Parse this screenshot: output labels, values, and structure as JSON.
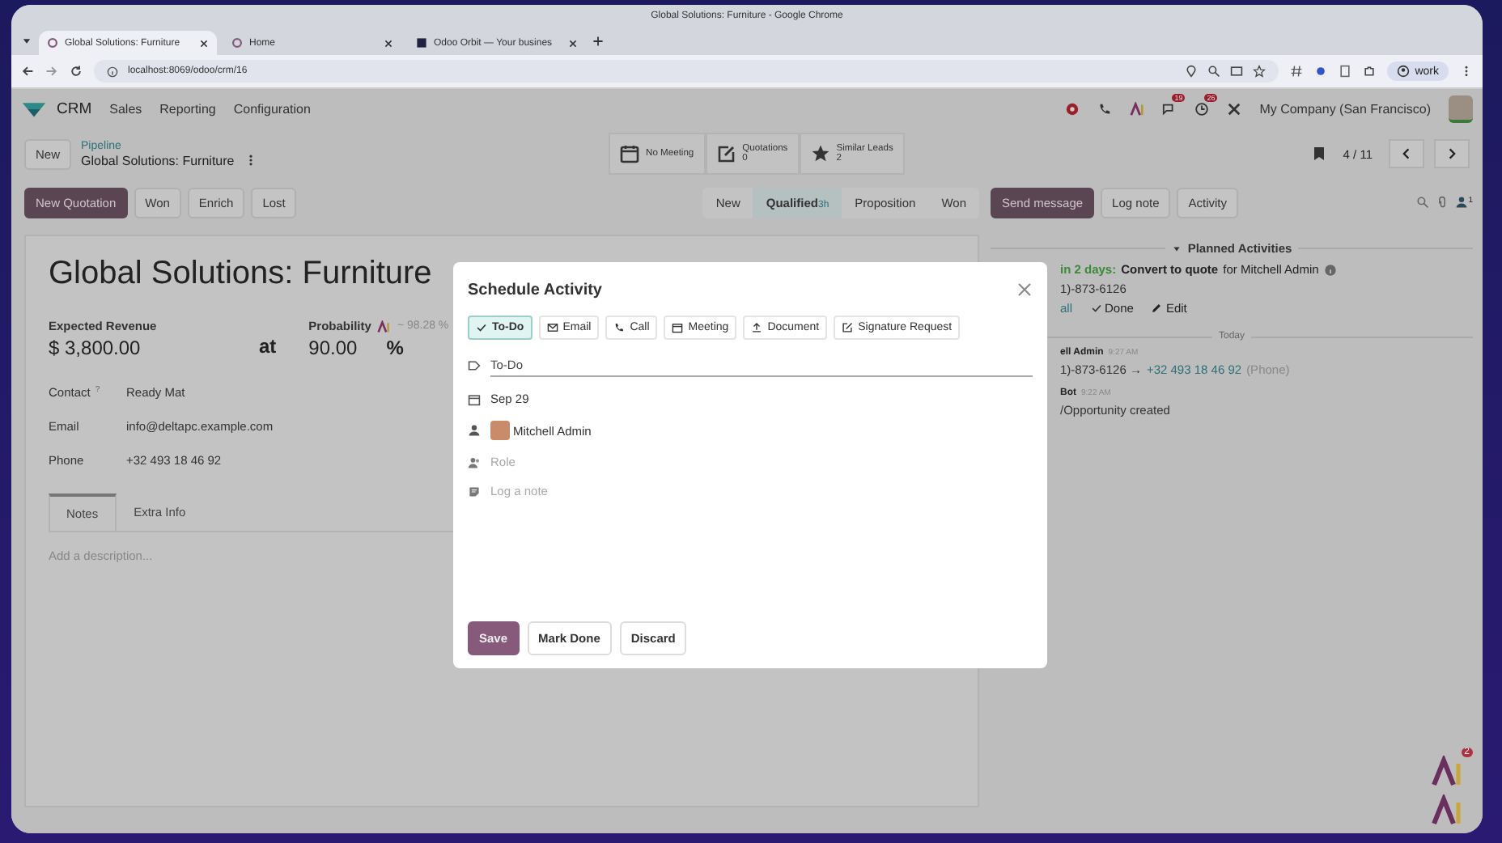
{
  "browser": {
    "title": "Global Solutions: Furniture - Google Chrome",
    "tabs": [
      {
        "label": "Global Solutions: Furniture",
        "selected": true,
        "kind": "odoo"
      },
      {
        "label": "Home",
        "selected": false,
        "kind": "odoo"
      },
      {
        "label": "Odoo Orbit — Your busines",
        "selected": false,
        "kind": "dark"
      }
    ],
    "url": "localhost:8069/odoo/crm/16",
    "profile": "work"
  },
  "navbar": {
    "app": "CRM",
    "menu": [
      "Sales",
      "Reporting",
      "Configuration"
    ],
    "messages_badge": "19",
    "activities_badge": "26",
    "company": "My Company (San Francisco)"
  },
  "control_panel": {
    "new_button": "New",
    "parent": "Pipeline",
    "title": "Global Solutions: Furniture",
    "smart_buttons": [
      {
        "kind": "calendar",
        "label": "No Meeting"
      },
      {
        "kind": "edit",
        "label": "Quotations",
        "value": "0"
      },
      {
        "kind": "star",
        "label": "Similar Leads",
        "value": "2"
      }
    ],
    "pager": "4 / 11"
  },
  "actions": [
    {
      "label": "New Quotation",
      "primary": true
    },
    {
      "label": "Won",
      "primary": false
    },
    {
      "label": "Enrich",
      "primary": false
    },
    {
      "label": "Lost",
      "primary": false
    }
  ],
  "stages": [
    {
      "label": "New",
      "selected": false
    },
    {
      "label": "Qualified",
      "selected": true,
      "duration": "3h"
    },
    {
      "label": "Proposition",
      "selected": false
    },
    {
      "label": "Won",
      "selected": false
    }
  ],
  "form": {
    "title": "Global Solutions: Furniture",
    "revenue_label": "Expected Revenue",
    "revenue": "$ 3,800.00",
    "at": "at",
    "probability_label": "Probability",
    "ai_estimate": "~ 98.28 %",
    "probability": "90.00",
    "percent": "%",
    "fields": [
      {
        "label": "Contact",
        "help": "?",
        "value": "Ready Mat"
      },
      {
        "label": "Email",
        "value": "info@deltapc.example.com"
      },
      {
        "label": "Phone",
        "value": "+32 493 18 46 92"
      }
    ],
    "tabs": [
      {
        "label": "Notes",
        "selected": true
      },
      {
        "label": "Extra Info",
        "selected": false
      }
    ],
    "description_placeholder": "Add a description..."
  },
  "chatter": {
    "buttons": [
      {
        "label": "Send message",
        "primary": true
      },
      {
        "label": "Log note",
        "primary": false
      },
      {
        "label": "Activity",
        "primary": false
      }
    ],
    "followers": "1",
    "planned_header": "Planned Activities",
    "activity": {
      "due": "in 2 days:",
      "summary": "Convert to quote",
      "assignee": "for Mitchell Admin",
      "phone": "1)-873-6126",
      "actions": [
        {
          "kind": "link",
          "label": "all"
        },
        {
          "kind": "done",
          "label": "Done"
        },
        {
          "kind": "edit",
          "label": "Edit"
        }
      ]
    },
    "divider": "Today",
    "messages": [
      {
        "author": "ell Admin",
        "time": "9:27 AM",
        "body": "1)-873-6126 →",
        "link": "+32 493 18 46 92",
        "suffix": "(Phone)"
      },
      {
        "author": "Bot",
        "time": "9:22 AM",
        "body": "/Opportunity created"
      }
    ]
  },
  "dialog": {
    "title": "Schedule Activity",
    "types": [
      {
        "kind": "todo",
        "label": "To-Do",
        "selected": true
      },
      {
        "kind": "email",
        "label": "Email",
        "selected": false
      },
      {
        "kind": "call",
        "label": "Call",
        "selected": false
      },
      {
        "kind": "meeting",
        "label": "Meeting",
        "selected": false
      },
      {
        "kind": "upload",
        "label": "Document",
        "selected": false
      },
      {
        "kind": "sign",
        "label": "Signature Request",
        "selected": false
      }
    ],
    "summary": "To-Do",
    "date": "Sep 29",
    "assignee": "Mitchell Admin",
    "role_placeholder": "Role",
    "note_placeholder": "Log a note",
    "buttons": [
      {
        "label": "Save",
        "primary": true
      },
      {
        "label": "Mark Done",
        "primary": false
      },
      {
        "label": "Discard",
        "primary": false
      }
    ]
  },
  "ai_badge": "2"
}
